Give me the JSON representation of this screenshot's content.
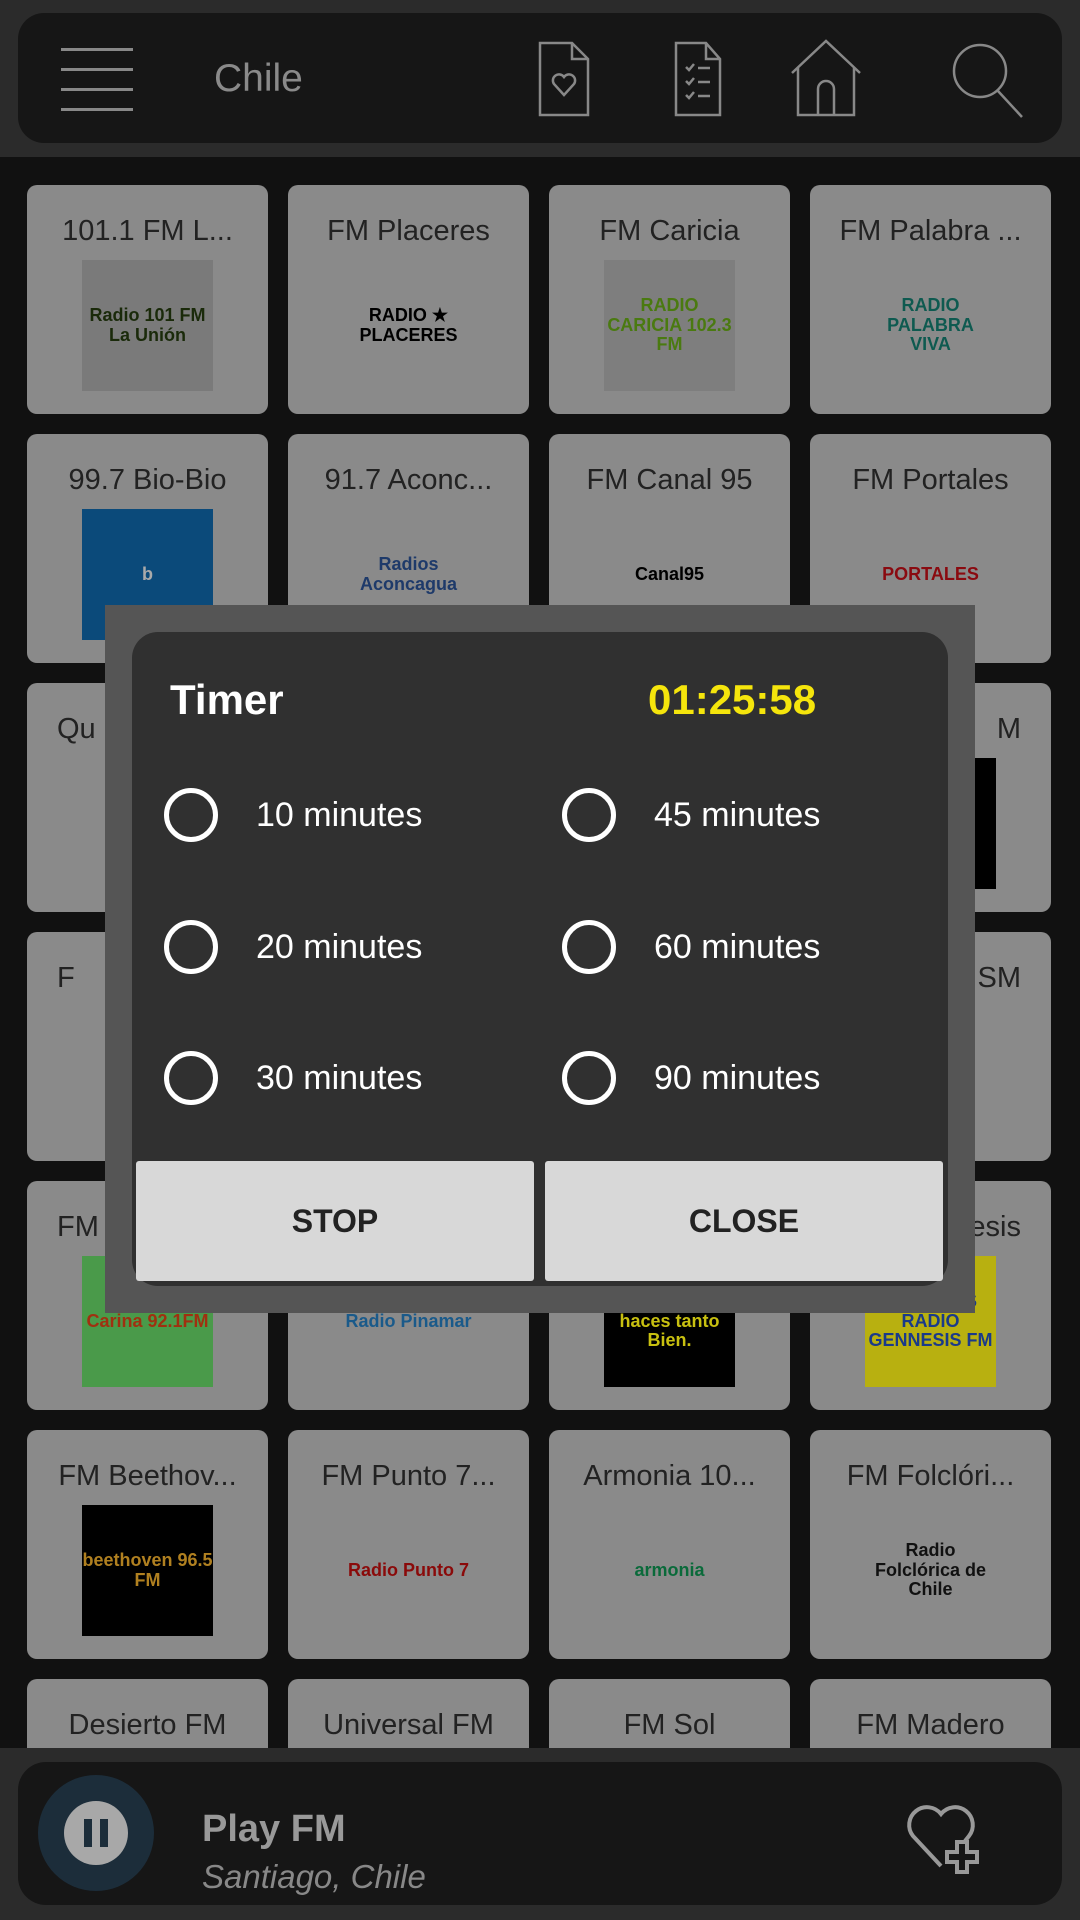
{
  "header": {
    "title": "Chile",
    "icons": [
      "menu-icon",
      "favorites-doc-icon",
      "checklist-icon",
      "home-icon",
      "search-icon"
    ]
  },
  "stations": [
    {
      "title": "101.1 FM L...",
      "logo_text": "Radio 101 FM La Unión",
      "logo_bg": "#7a7a7a",
      "logo_fg": "#1a2a0a"
    },
    {
      "title": "FM Placeres",
      "logo_text": "RADIO ★ PLACERES",
      "logo_bg": "#8a8a8a",
      "logo_fg": "#000"
    },
    {
      "title": "FM Caricia",
      "logo_text": "RADIO CARICIA 102.3 FM",
      "logo_bg": "#7e7e7e",
      "logo_fg": "#4a7a10"
    },
    {
      "title": "FM Palabra ...",
      "logo_text": "RADIO PALABRA VIVA",
      "logo_bg": "#8a8a8a",
      "logo_fg": "#0e5a50"
    },
    {
      "title": "99.7  Bio-Bio",
      "logo_text": "b",
      "logo_bg": "#0b4a7a",
      "logo_fg": "#aaa"
    },
    {
      "title": "91.7 Aconc...",
      "logo_text": "Radios Aconcagua",
      "logo_bg": "#8a8a8a",
      "logo_fg": "#1e3a6a"
    },
    {
      "title": "FM Canal 95",
      "logo_text": "Canal95",
      "logo_bg": "#8a8a8a",
      "logo_fg": "#000"
    },
    {
      "title": "FM Portales",
      "logo_text": "PORTALES",
      "logo_bg": "#8a8a8a",
      "logo_fg": "#8a0a10"
    },
    {
      "title": "Qu",
      "logo_text": "",
      "logo_bg": "#8a8a8a",
      "logo_fg": "#000"
    },
    {
      "title": "",
      "logo_text": "",
      "logo_bg": "#8a8a8a",
      "logo_fg": "#000"
    },
    {
      "title": "",
      "logo_text": "",
      "logo_bg": "#8a8a8a",
      "logo_fg": "#000"
    },
    {
      "title": "M",
      "logo_text": "",
      "logo_bg": "#000",
      "logo_fg": "#fff"
    },
    {
      "title": "F",
      "logo_text": "",
      "logo_bg": "#8a8a8a",
      "logo_fg": "#000"
    },
    {
      "title": "",
      "logo_text": "",
      "logo_bg": "#8a8a8a",
      "logo_fg": "#000"
    },
    {
      "title": "",
      "logo_text": "",
      "logo_bg": "#8a8a8a",
      "logo_fg": "#000"
    },
    {
      "title": "SM",
      "logo_text": "",
      "logo_bg": "#8a8a8a",
      "logo_fg": "#000"
    },
    {
      "title": "FM",
      "logo_text": "Carina 92.1FM",
      "logo_bg": "#4a9a4a",
      "logo_fg": "#a03010"
    },
    {
      "title": "",
      "logo_text": "Radio Pinamar",
      "logo_bg": "#8a8a8a",
      "logo_fg": "#1a5a8a"
    },
    {
      "title": "",
      "logo_text": "OK FM Me haces tanto Bien.",
      "logo_bg": "#000",
      "logo_fg": "#c8c010"
    },
    {
      "title": "esis",
      "logo_text": "GENNESIS RADIO GENNESIS FM",
      "logo_bg": "#b8b010",
      "logo_fg": "#1a3a8a"
    },
    {
      "title": "FM Beethov...",
      "logo_text": "beethoven 96.5 FM",
      "logo_bg": "#000",
      "logo_fg": "#b08020"
    },
    {
      "title": "FM Punto 7...",
      "logo_text": "Radio Punto 7",
      "logo_bg": "#8a8a8a",
      "logo_fg": "#8a0a0a"
    },
    {
      "title": "Armonia 10...",
      "logo_text": "armonia",
      "logo_bg": "#8a8a8a",
      "logo_fg": "#0a6a3a"
    },
    {
      "title": "FM Folclóri...",
      "logo_text": "Radio Folclórica de Chile",
      "logo_bg": "#8a8a8a",
      "logo_fg": "#111"
    },
    {
      "title": "Desierto FM",
      "logo_text": "",
      "logo_bg": "#8a8a8a",
      "logo_fg": "#000"
    },
    {
      "title": "Universal FM",
      "logo_text": "",
      "logo_bg": "#8a8a8a",
      "logo_fg": "#000"
    },
    {
      "title": "FM Sol",
      "logo_text": "",
      "logo_bg": "#8a8a8a",
      "logo_fg": "#000"
    },
    {
      "title": "FM Madero",
      "logo_text": "",
      "logo_bg": "#8a8a8a",
      "logo_fg": "#000"
    }
  ],
  "player": {
    "title": "Play FM",
    "subtitle": "Santiago, Chile",
    "state": "playing"
  },
  "dialog": {
    "title": "Timer",
    "remaining": "01:25:58",
    "remaining_color": "#f5e50c",
    "options": [
      "10 minutes",
      "20 minutes",
      "30 minutes",
      "45 minutes",
      "60 minutes",
      "90 minutes"
    ],
    "stop_label": "STOP",
    "close_label": "CLOSE"
  }
}
